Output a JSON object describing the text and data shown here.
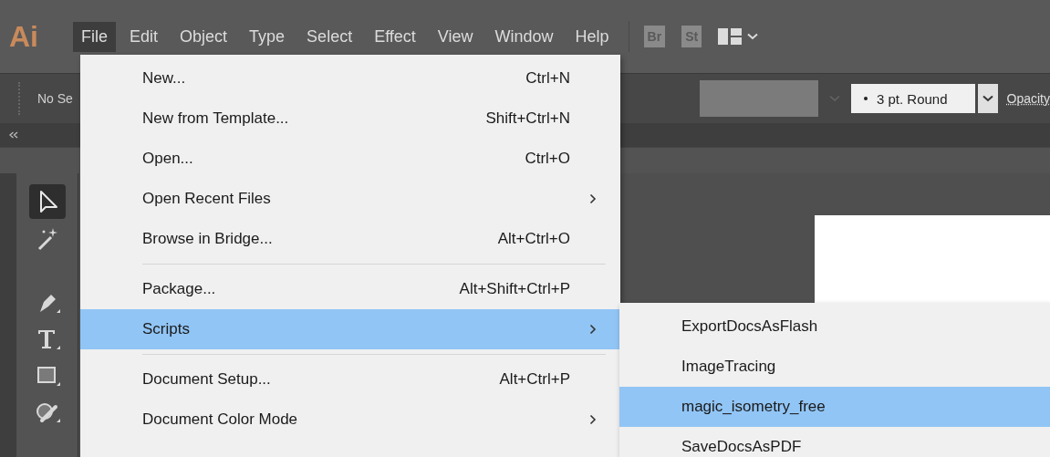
{
  "app_logo": "Ai",
  "menubar": {
    "items": [
      {
        "label": "File",
        "selected": true
      },
      {
        "label": "Edit",
        "selected": false
      },
      {
        "label": "Object",
        "selected": false
      },
      {
        "label": "Type",
        "selected": false
      },
      {
        "label": "Select",
        "selected": false
      },
      {
        "label": "Effect",
        "selected": false
      },
      {
        "label": "View",
        "selected": false
      },
      {
        "label": "Window",
        "selected": false
      },
      {
        "label": "Help",
        "selected": false
      }
    ],
    "bridge_button": "Br",
    "stock_button": "St"
  },
  "control_bar": {
    "selection_label": "No Se",
    "stroke_profile": "3 pt. Round",
    "opacity_link": "Opacity"
  },
  "toolbar": {
    "tools": [
      {
        "kind": "selection",
        "selected": true
      },
      {
        "kind": "magic-wand",
        "selected": false
      },
      {
        "kind": "pen",
        "selected": false
      },
      {
        "kind": "type",
        "selected": false
      },
      {
        "kind": "rectangle",
        "selected": false
      },
      {
        "kind": "shaper",
        "selected": false
      }
    ]
  },
  "file_menu": {
    "items": [
      {
        "kind": "item",
        "label": "New...",
        "shortcut": "Ctrl+N",
        "submenu": false,
        "selected": false
      },
      {
        "kind": "item",
        "label": "New from Template...",
        "shortcut": "Shift+Ctrl+N",
        "submenu": false,
        "selected": false
      },
      {
        "kind": "item",
        "label": "Open...",
        "shortcut": "Ctrl+O",
        "submenu": false,
        "selected": false
      },
      {
        "kind": "item",
        "label": "Open Recent Files",
        "submenu": true,
        "selected": false
      },
      {
        "kind": "item",
        "label": "Browse in Bridge...",
        "shortcut": "Alt+Ctrl+O",
        "submenu": false,
        "selected": false
      },
      {
        "kind": "separator"
      },
      {
        "kind": "item",
        "label": "Package...",
        "shortcut": "Alt+Shift+Ctrl+P",
        "submenu": false,
        "selected": false
      },
      {
        "kind": "item",
        "label": "Scripts",
        "submenu": true,
        "selected": true
      },
      {
        "kind": "separator"
      },
      {
        "kind": "item",
        "label": "Document Setup...",
        "shortcut": "Alt+Ctrl+P",
        "submenu": false,
        "selected": false
      },
      {
        "kind": "item",
        "label": "Document Color Mode",
        "submenu": true,
        "selected": false
      }
    ]
  },
  "scripts_submenu": {
    "items": [
      {
        "label": "ExportDocsAsFlash",
        "selected": false
      },
      {
        "label": "ImageTracing",
        "selected": false
      },
      {
        "label": "magic_isometry_free",
        "selected": true
      },
      {
        "label": "SaveDocsAsPDF",
        "selected": false
      }
    ]
  }
}
